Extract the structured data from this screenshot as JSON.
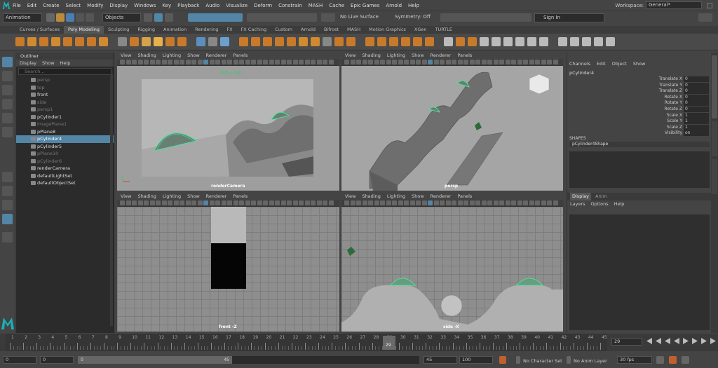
{
  "menubar": {
    "items": [
      "File",
      "Edit",
      "Create",
      "Select",
      "Modify",
      "Display",
      "Windows",
      "Key",
      "Playback",
      "Audio",
      "Visualize",
      "Deform",
      "Constrain",
      "MASH",
      "Cache",
      "Epic Games",
      "Arnold",
      "Help"
    ],
    "workspace_label": "Workspace:",
    "workspace_value": "General*"
  },
  "statusline": {
    "mode": "Animation",
    "objects": "Objects",
    "live_surface": "No Live Surface",
    "symmetry": "Symmetry: Off",
    "sign_in": "Sign In"
  },
  "shelf": {
    "tabs": [
      "Curves / Surfaces",
      "Poly Modeling",
      "Sculpting",
      "Rigging",
      "Animation",
      "Rendering",
      "FX",
      "FX Caching",
      "Custom",
      "Arnold",
      "Bifrost",
      "MASH",
      "Motion Graphics",
      "XGen",
      "TURTLE"
    ],
    "active_tab": 1
  },
  "outliner": {
    "title": "Outliner",
    "menu": [
      "Display",
      "Show",
      "Help"
    ],
    "search_placeholder": "Search...",
    "items": [
      {
        "label": "persp",
        "dim": true
      },
      {
        "label": "top",
        "dim": true
      },
      {
        "label": "front",
        "dim": false
      },
      {
        "label": "side",
        "dim": true
      },
      {
        "label": "persp1",
        "dim": true
      },
      {
        "label": "pCylinder1",
        "dim": false
      },
      {
        "label": "imagePlane1",
        "dim": true
      },
      {
        "label": "pPlane8",
        "dim": false
      },
      {
        "label": "pCylinder4",
        "dim": false,
        "selected": true
      },
      {
        "label": "pCylinder5",
        "dim": false
      },
      {
        "label": "pPlane10",
        "dim": true
      },
      {
        "label": "pCylinder6",
        "dim": true
      },
      {
        "label": "renderCamera",
        "dim": false
      },
      {
        "label": "defaultLightSet",
        "dim": false
      },
      {
        "label": "defaultObjectSet",
        "dim": false
      }
    ]
  },
  "viewport_menu": [
    "View",
    "Shading",
    "Lighting",
    "Show",
    "Renderer",
    "Panels"
  ],
  "viewports": {
    "top_left": {
      "label": "renderCamera",
      "resolution": "960 x 540"
    },
    "top_right": {
      "label": "persp"
    },
    "bottom_left": {
      "label": "front -Z"
    },
    "bottom_right": {
      "label": "side -X"
    }
  },
  "channel_box": {
    "menu": [
      "Channels",
      "Edit",
      "Object",
      "Show"
    ],
    "object": "pCylinder4",
    "attributes": [
      {
        "name": "Translate X",
        "value": "0"
      },
      {
        "name": "Translate Y",
        "value": "0"
      },
      {
        "name": "Translate Z",
        "value": "0"
      },
      {
        "name": "Rotate X",
        "value": "0"
      },
      {
        "name": "Rotate Y",
        "value": "0"
      },
      {
        "name": "Rotate Z",
        "value": "0"
      },
      {
        "name": "Scale X",
        "value": "1"
      },
      {
        "name": "Scale Y",
        "value": "1"
      },
      {
        "name": "Scale Z",
        "value": "1"
      },
      {
        "name": "Visibility",
        "value": "on"
      }
    ],
    "shapes_header": "SHAPES",
    "shape_name": "pCylinder4Shape",
    "layer_tabs": [
      "Display",
      "Anim"
    ],
    "layer_menu": [
      "Layers",
      "Options",
      "Help"
    ],
    "side_tabs": [
      "Channel Box / Layer Editor",
      "Attribute Editor",
      "Modeling Toolkit"
    ]
  },
  "timeline": {
    "ticks": [
      "1",
      "2",
      "3",
      "4",
      "5",
      "6",
      "7",
      "8",
      "9",
      "10",
      "11",
      "12",
      "13",
      "14",
      "15",
      "16",
      "17",
      "18",
      "19",
      "20",
      "21",
      "22",
      "23",
      "24",
      "25",
      "26",
      "27",
      "28",
      "29",
      "30",
      "31",
      "32",
      "33",
      "34",
      "35",
      "36",
      "37",
      "38",
      "39",
      "40",
      "41",
      "42",
      "43",
      "44",
      "45"
    ],
    "current_frame": "29",
    "current_frame_field": "29"
  },
  "range": {
    "start": "0",
    "start_inner": "0",
    "slider_start": "0",
    "slider_end": "45",
    "end_inner": "45",
    "end": "100",
    "character_set": "No Character Set",
    "anim_layer": "No Anim Layer",
    "fps": "30 fps"
  },
  "colors": {
    "accent_blue": "#5285a6",
    "selection_green": "#46e39b",
    "playhead": "#c8c8c8"
  }
}
